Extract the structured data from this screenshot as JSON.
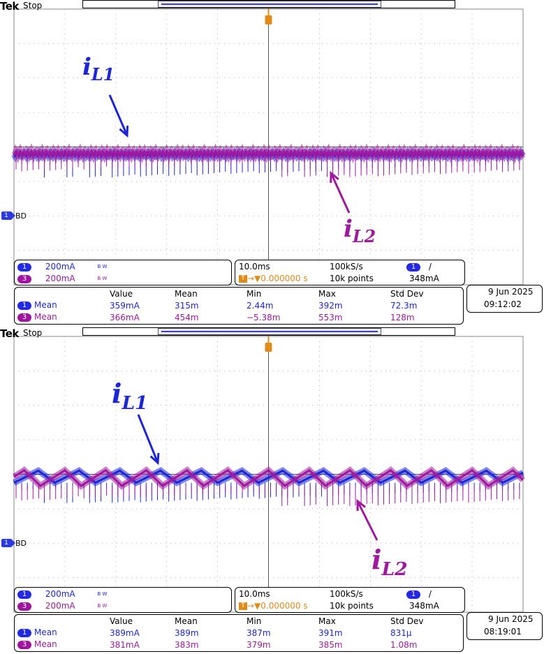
{
  "scopes": [
    {
      "brand": "Tek",
      "run_state": "Stop",
      "ground_label": "BD",
      "annotations": {
        "il1": {
          "main": "i",
          "sub": "L1"
        },
        "il2": {
          "main": "i",
          "sub": "L2"
        }
      },
      "channels": [
        {
          "badge": "1",
          "scale": "200mA",
          "bw": "B W"
        },
        {
          "badge": "3",
          "scale": "200mA",
          "bw": "B W"
        }
      ],
      "timebase": {
        "time_div": "10.0ms",
        "sample_rate": "100kS/s",
        "trigger_pos": "0.000000 s",
        "record_length": "10k points",
        "trigger_channel": "1",
        "trigger_slope": "/",
        "trigger_level": "348mA"
      },
      "measurements": {
        "headers": [
          "Value",
          "Mean",
          "Min",
          "Max",
          "Std Dev"
        ],
        "rows": [
          {
            "badge": "1",
            "label": "Mean",
            "value": "359mA",
            "mean": "315m",
            "min": "2.44m",
            "max": "392m",
            "std": "72.3m"
          },
          {
            "badge": "3",
            "label": "Mean",
            "value": "366mA",
            "mean": "454m",
            "min": "−5.38m",
            "max": "553m",
            "std": "128m"
          }
        ]
      },
      "date": "9 Jun  2025",
      "time": "09:12:02"
    },
    {
      "brand": "Tek",
      "run_state": "Stop",
      "ground_label": "BD",
      "annotations": {
        "il1": {
          "main": "i",
          "sub": "L1"
        },
        "il2": {
          "main": "i",
          "sub": "L2"
        }
      },
      "channels": [
        {
          "badge": "1",
          "scale": "200mA",
          "bw": "B W"
        },
        {
          "badge": "3",
          "scale": "200mA",
          "bw": "B W"
        }
      ],
      "timebase": {
        "time_div": "10.0ms",
        "sample_rate": "100kS/s",
        "trigger_pos": "0.000000 s",
        "record_length": "10k points",
        "trigger_channel": "1",
        "trigger_slope": "/",
        "trigger_level": "348mA"
      },
      "measurements": {
        "headers": [
          "Value",
          "Mean",
          "Min",
          "Max",
          "Std Dev"
        ],
        "rows": [
          {
            "badge": "1",
            "label": "Mean",
            "value": "389mA",
            "mean": "389m",
            "min": "387m",
            "max": "391m",
            "std": "831μ"
          },
          {
            "badge": "3",
            "label": "Mean",
            "value": "381mA",
            "mean": "383m",
            "min": "379m",
            "max": "385m",
            "std": "1.08m"
          }
        ]
      },
      "date": "9 Jun  2025",
      "time": "08:19:01"
    }
  ],
  "colors": {
    "ch1": "#1d26d6",
    "ch3": "#a0189f",
    "trigger": "#e08a17",
    "grid": "#777777"
  },
  "chart_data": [
    {
      "type": "line",
      "xlabel": "",
      "ylabel": "",
      "x_units_per_div": "10.0ms",
      "y_units_per_div": "200mA",
      "grid": true,
      "series": [
        {
          "name": "iL1",
          "channel": 1,
          "mean_mA": 359,
          "ripple_periods": 0,
          "ripple_pp_mA": 30
        },
        {
          "name": "iL2",
          "channel": 3,
          "mean_mA": 366,
          "ripple_periods": 0,
          "ripple_pp_mA": 40
        }
      ]
    },
    {
      "type": "line",
      "xlabel": "",
      "ylabel": "",
      "x_units_per_div": "10.0ms",
      "y_units_per_div": "200mA",
      "grid": true,
      "series": [
        {
          "name": "iL1",
          "channel": 1,
          "mean_mA": 389,
          "ripple_periods": 12.5,
          "ripple_pp_mA": 70
        },
        {
          "name": "iL2",
          "channel": 3,
          "mean_mA": 381,
          "ripple_periods": 12.5,
          "ripple_pp_mA": 90
        }
      ]
    }
  ]
}
